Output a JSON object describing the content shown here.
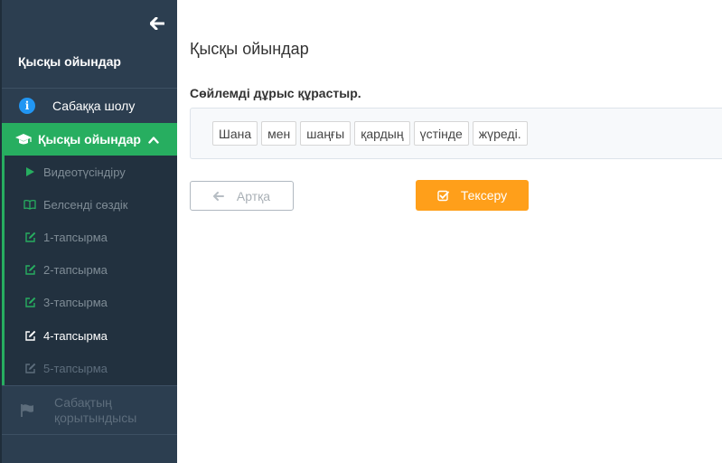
{
  "sidebar": {
    "title": "Қысқы ойындар",
    "overview_label": "Сабаққа шолу",
    "active_section_label": "Қысқы ойындар",
    "submenu": [
      {
        "label": "Видеотүсіндіру",
        "icon": "play-icon",
        "state": "done"
      },
      {
        "label": "Белсенді сөздік",
        "icon": "book-icon",
        "state": "done"
      },
      {
        "label": "1-тапсырма",
        "icon": "edit-icon",
        "state": "done"
      },
      {
        "label": "2-тапсырма",
        "icon": "edit-icon",
        "state": "done"
      },
      {
        "label": "3-тапсырма",
        "icon": "edit-icon",
        "state": "done"
      },
      {
        "label": "4-тапсырма",
        "icon": "edit-icon",
        "state": "current"
      },
      {
        "label": "5-тапсырма",
        "icon": "edit-icon",
        "state": "locked"
      }
    ],
    "final_label": "Сабақтың қорытындысы"
  },
  "main": {
    "title": "Қысқы ойындар",
    "instruction": "Сөйлемді дұрыс құрастыр.",
    "words": [
      "Шана",
      "мен",
      "шаңғы",
      "қардың",
      "үстінде",
      "жүреді."
    ],
    "back_label": "Артқа",
    "check_label": "Тексеру"
  },
  "colors": {
    "sidebar_bg": "#2c3e50",
    "accent_green": "#27ae60",
    "accent_orange": "#ff9f1a",
    "info_blue": "#2196f3"
  }
}
